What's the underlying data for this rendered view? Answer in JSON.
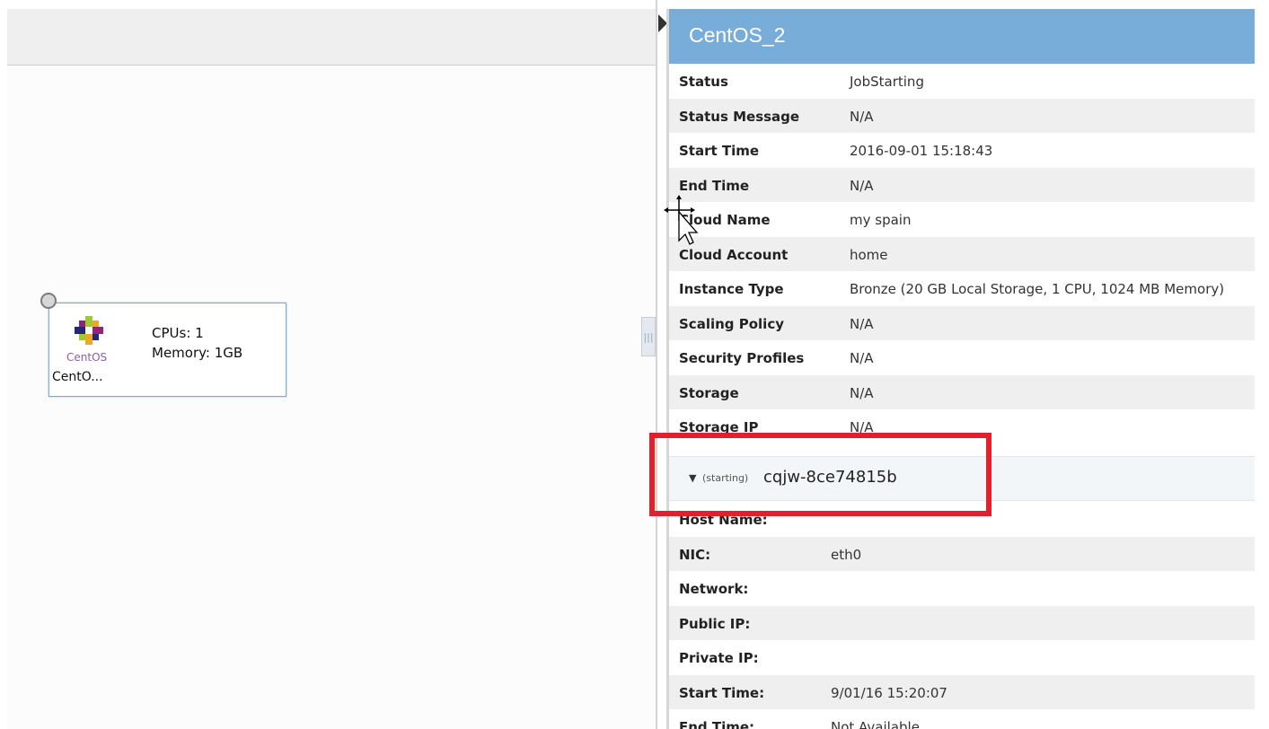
{
  "node": {
    "logo_text": "CentOS",
    "name": "CentO...",
    "cpus": "CPUs: 1",
    "memory": "Memory: 1GB"
  },
  "panel": {
    "title": "CentOS_2",
    "properties": [
      {
        "label": "Status",
        "value": "JobStarting"
      },
      {
        "label": "Status Message",
        "value": "N/A"
      },
      {
        "label": "Start Time",
        "value": "2016-09-01 15:18:43"
      },
      {
        "label": "End Time",
        "value": "N/A"
      },
      {
        "label": "Cloud Name",
        "value": "my spain"
      },
      {
        "label": "Cloud Account",
        "value": "home"
      },
      {
        "label": "Instance Type",
        "value": "Bronze (20 GB Local Storage, 1 CPU, 1024 MB Memory)"
      },
      {
        "label": "Scaling Policy",
        "value": "N/A"
      },
      {
        "label": "Security Profiles",
        "value": "N/A"
      },
      {
        "label": "Storage",
        "value": "N/A"
      },
      {
        "label": "Storage IP",
        "value": "N/A"
      }
    ],
    "instance": {
      "state": "(starting)",
      "name": "cqjw-8ce74815b"
    },
    "instance_properties": [
      {
        "label": "Host Name:",
        "value": ""
      },
      {
        "label": "NIC:",
        "value": "eth0"
      },
      {
        "label": "Network:",
        "value": ""
      },
      {
        "label": "Public IP:",
        "value": ""
      },
      {
        "label": "Private IP:",
        "value": ""
      },
      {
        "label": "Start Time:",
        "value": "9/01/16 15:20:07"
      },
      {
        "label": "End Time:",
        "value": "Not Available"
      }
    ]
  },
  "colors": {
    "header": "#78acd9",
    "highlight": "#e51e2b",
    "row_alt": "#efefef"
  },
  "icons": {
    "expand": "caret-down-icon",
    "node_logo": "centos-logo-icon"
  }
}
